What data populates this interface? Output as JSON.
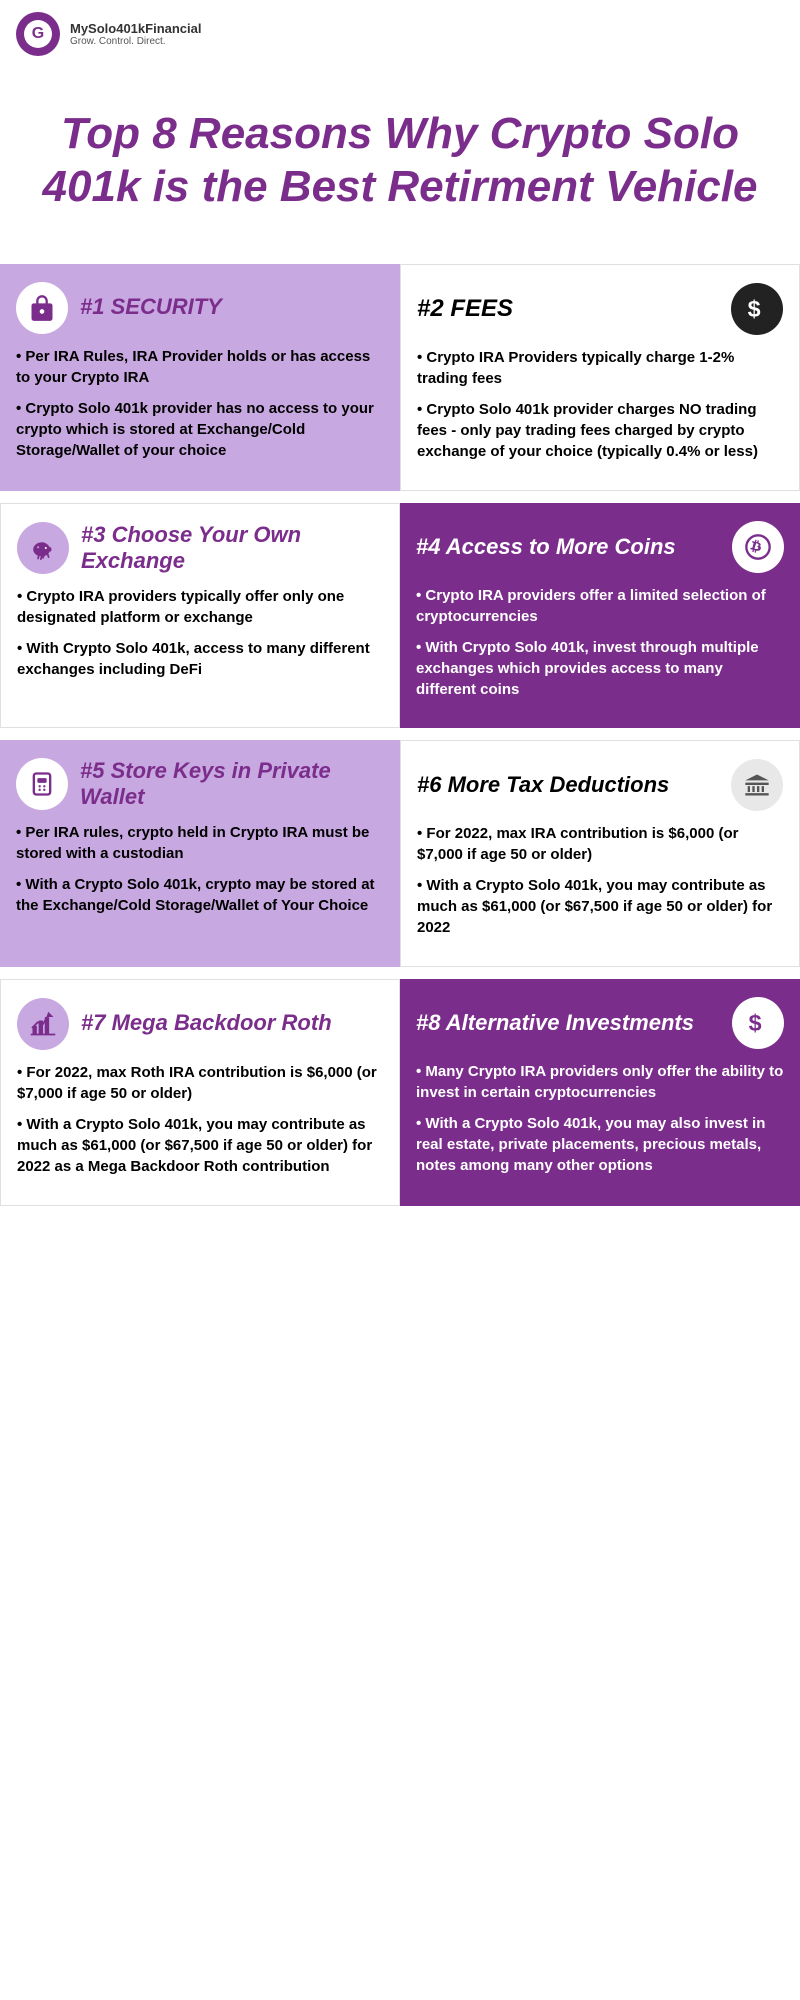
{
  "header": {
    "logo_title": "MySolo401kFinancial",
    "logo_subtitle": "Grow. Control. Direct.",
    "logo_letter": "G"
  },
  "main_title": "Top 8 Reasons Why Crypto Solo 401k is the Best Retirment Vehicle",
  "cells": [
    {
      "id": "security",
      "number": "#1",
      "title": "SECURITY",
      "style": "light",
      "icon": "lock",
      "body": [
        "• Per IRA Rules, IRA Provider holds or has access to your Crypto IRA",
        "• Crypto Solo 401k provider has no access to your crypto which is stored at Exchange/Cold Storage/Wallet of your choice"
      ]
    },
    {
      "id": "fees",
      "number": "#2",
      "title": "FEES",
      "style": "white",
      "icon": "dollar-dark",
      "body": [
        "• Crypto IRA Providers typically charge 1-2% trading fees",
        "• Crypto Solo 401k provider charges NO trading fees - only pay trading fees charged by crypto exchange of your choice (typically 0.4% or less)"
      ]
    },
    {
      "id": "exchange",
      "number": "#3",
      "title": "Choose Your Own Exchange",
      "style": "white",
      "icon": "piggy",
      "body": [
        "• Crypto IRA providers typically offer only one designated platform or exchange",
        "• With Crypto Solo 401k, access to many different exchanges including DeFi"
      ]
    },
    {
      "id": "coins",
      "number": "#4",
      "title": "Access to More Coins",
      "style": "dark",
      "icon": "bitcoin-light",
      "body": [
        "• Crypto IRA providers offer a limited selection of cryptocurrencies",
        "• With Crypto Solo 401k, invest through multiple exchanges which provides access to many different coins"
      ]
    },
    {
      "id": "wallet",
      "number": "#5",
      "title": "Store Keys in Private Wallet",
      "style": "light",
      "icon": "key",
      "body": [
        "• Per IRA rules, crypto held in Crypto IRA must be stored with a custodian",
        "• With a Crypto Solo 401k, crypto may be stored at the Exchange/Cold Storage/Wallet of Your Choice"
      ]
    },
    {
      "id": "deductions",
      "number": "#6",
      "title": "More Tax Deductions",
      "style": "white",
      "icon": "bank",
      "body": [
        "• For 2022, max IRA contribution is $6,000 (or $7,000 if age 50 or older)",
        "• With a Crypto Solo 401k, you may contribute as much as $61,000 (or $67,500 if age 50 or older) for 2022"
      ]
    },
    {
      "id": "backdoor",
      "number": "#7",
      "title": "Mega Backdoor Roth",
      "style": "white",
      "icon": "chart",
      "body": [
        "• For 2022, max Roth IRA contribution is $6,000 (or $7,000 if age 50 or older)",
        "• With a Crypto Solo 401k, you may contribute as much as $61,000 (or $67,500 if age 50 or older) for 2022 as a Mega Backdoor Roth contribution"
      ]
    },
    {
      "id": "alternative",
      "number": "#8",
      "title": "Alternative Investments",
      "style": "dark",
      "icon": "dollar-light",
      "body": [
        "• Many Crypto IRA providers only offer the ability to invest in certain cryptocurrencies",
        "• With a Crypto Solo 401k, you may also invest in real estate, private placements, precious metals, notes among many other options"
      ]
    }
  ]
}
